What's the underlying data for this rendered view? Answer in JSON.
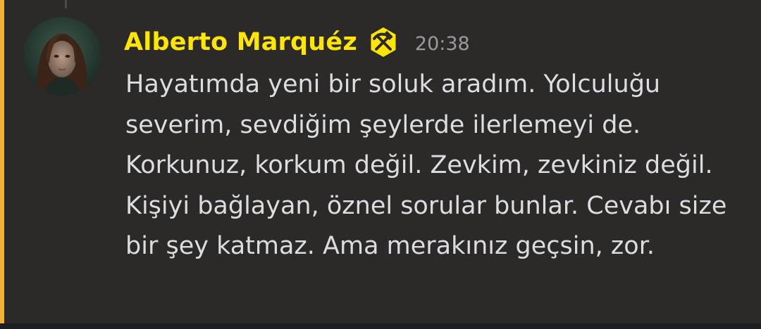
{
  "message": {
    "author": "Alberto Marquéz",
    "timestamp": "20:38",
    "text": "Hayatımda yeni bir soluk aradım. Yolculuğu severim, sevdiğim şeylerde ilerlemeyi de. Korkunuz, korkum değil. Zevkim, zevkiniz değil. Kişiyi bağlayan, öznel sorular bunlar. Cevabı size bir şey katmaz. Ama merakınız geçsin, zor.",
    "avatar_icon": "user-avatar-portrait",
    "badge_icon": "hammer-pick-role-icon"
  },
  "colors": {
    "background": "#2b2a28",
    "highlight_bar": "#f0b232",
    "username": "#ffe500",
    "badge": "#ffe500",
    "message_text": "#dcdde0",
    "timestamp": "#9a9a9f"
  }
}
